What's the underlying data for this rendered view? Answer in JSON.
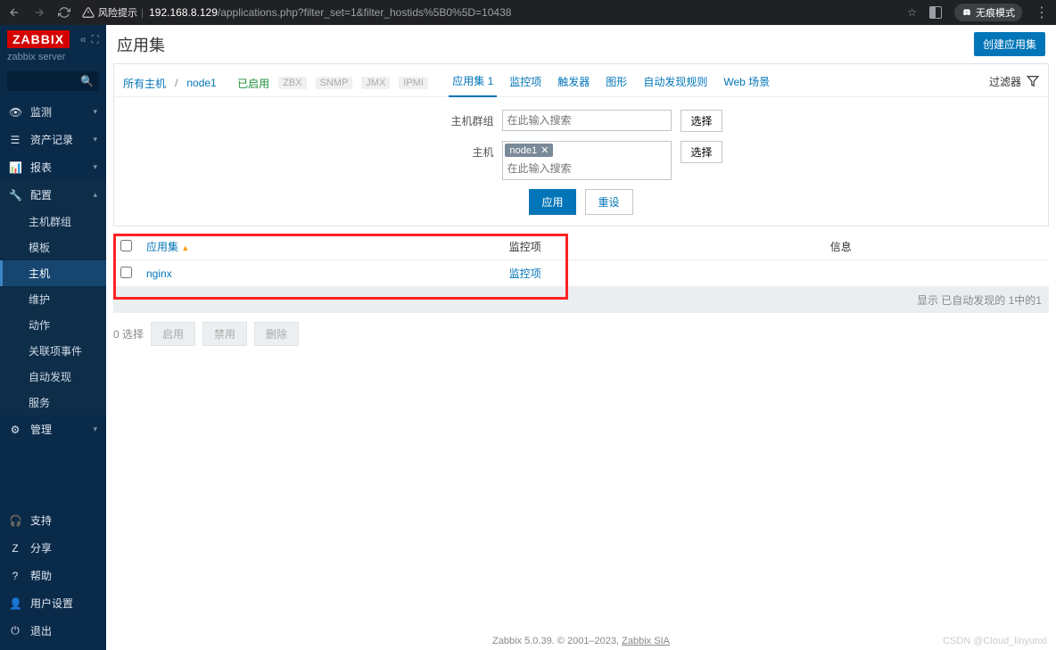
{
  "browser": {
    "warn_label": "风险提示",
    "url_host": "192.168.8.129",
    "url_path": "/applications.php?filter_set=1&filter_hostids%5B0%5D=10438",
    "incognito_label": "无痕模式"
  },
  "sidebar": {
    "logo": "ZABBIX",
    "server_label": "zabbix server",
    "sections": [
      {
        "icon": "eye",
        "label": "监测"
      },
      {
        "icon": "list",
        "label": "资产记录"
      },
      {
        "icon": "bar",
        "label": "报表"
      },
      {
        "icon": "wrench",
        "label": "配置"
      },
      {
        "icon": "gear",
        "label": "管理"
      }
    ],
    "config_items": [
      "主机群组",
      "模板",
      "主机",
      "维护",
      "动作",
      "关联项事件",
      "自动发现",
      "服务"
    ],
    "footer": [
      {
        "icon": "support",
        "label": "支持"
      },
      {
        "icon": "share",
        "label": "分享"
      },
      {
        "icon": "help",
        "label": "帮助"
      },
      {
        "icon": "user",
        "label": "用户设置"
      },
      {
        "icon": "exit",
        "label": "退出"
      }
    ]
  },
  "page": {
    "title": "应用集",
    "create_btn": "创建应用集"
  },
  "breadcrumb": {
    "all_hosts": "所有主机",
    "host": "node1",
    "enabled": "已启用",
    "tags": [
      "ZBX",
      "SNMP",
      "JMX",
      "IPMI"
    ],
    "tabs": [
      {
        "label": "应用集 1",
        "active": true
      },
      {
        "label": "监控项"
      },
      {
        "label": "触发器"
      },
      {
        "label": "图形"
      },
      {
        "label": "自动发现规则"
      },
      {
        "label": "Web 场景"
      }
    ],
    "filter_label": "过滤器"
  },
  "filter": {
    "hostgroup_label": "主机群组",
    "host_label": "主机",
    "placeholder": "在此输入搜索",
    "host_chip": "node1",
    "select_btn": "选择",
    "apply_btn": "应用",
    "reset_btn": "重设"
  },
  "table": {
    "col_appset": "应用集",
    "col_monitor": "监控项",
    "col_info": "信息",
    "rows": [
      {
        "name": "nginx",
        "monitor": "监控项"
      }
    ],
    "foot": "显示 已自动发现的 1中的1"
  },
  "actions": {
    "selected": "0 选择",
    "enable": "启用",
    "disable": "禁用",
    "delete": "删除"
  },
  "footer": {
    "text": "Zabbix 5.0.39. © 2001–2023, ",
    "link": "Zabbix SIA"
  },
  "watermark": "CSDN @Cloud_linyunxi"
}
